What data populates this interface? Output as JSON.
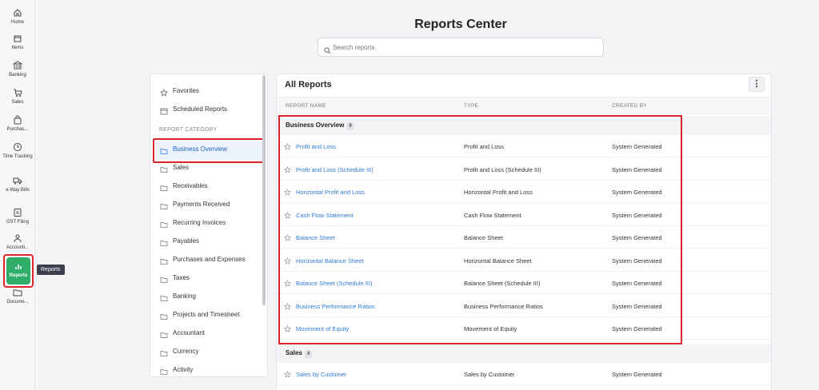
{
  "nav": {
    "items": [
      {
        "label": "Home",
        "icon": "home-icon"
      },
      {
        "label": "Items",
        "icon": "box-icon"
      },
      {
        "label": "Banking",
        "icon": "bank-icon"
      },
      {
        "label": "Sales",
        "icon": "cart-icon"
      },
      {
        "label": "Purchas...",
        "icon": "bag-icon"
      },
      {
        "label": "Time Tracking",
        "icon": "clock-icon"
      },
      {
        "label": "e-Way Bills",
        "icon": "truck-icon"
      },
      {
        "label": "GST Filing",
        "icon": "gst-icon"
      },
      {
        "label": "Accounti...",
        "icon": "user-icon"
      },
      {
        "label": "Reports",
        "icon": "chart-icon"
      },
      {
        "label": "Docume...",
        "icon": "folder-icon"
      }
    ],
    "tooltip": "Reports"
  },
  "header": {
    "title": "Reports Center",
    "search_placeholder": "Search reports"
  },
  "categories": {
    "top": [
      {
        "label": "Favorites",
        "icon": "star-icon"
      },
      {
        "label": "Scheduled Reports",
        "icon": "calendar-icon"
      }
    ],
    "heading": "REPORT CATEGORY",
    "items": [
      {
        "label": "Business Overview"
      },
      {
        "label": "Sales"
      },
      {
        "label": "Receivables"
      },
      {
        "label": "Payments Received"
      },
      {
        "label": "Recurring Invoices"
      },
      {
        "label": "Payables"
      },
      {
        "label": "Purchases and Expenses"
      },
      {
        "label": "Taxes"
      },
      {
        "label": "Banking"
      },
      {
        "label": "Projects and Timesheet"
      },
      {
        "label": "Accountant"
      },
      {
        "label": "Currency"
      },
      {
        "label": "Activity"
      }
    ],
    "selected": "Business Overview"
  },
  "main": {
    "title": "All Reports",
    "more_label": "⋮",
    "columns": {
      "name": "REPORT NAME",
      "type": "TYPE",
      "created_by": "CREATED BY"
    },
    "groups": [
      {
        "label": "Business Overview",
        "count": "9",
        "rows": [
          {
            "name": "Profit and Loss",
            "type": "Profit and Loss",
            "by": "System Generated"
          },
          {
            "name": "Profit and Loss (Schedule III)",
            "type": "Profit and Loss (Schedule III)",
            "by": "System Generated"
          },
          {
            "name": "Horizontal Profit and Loss",
            "type": "Horizontal Profit and Loss",
            "by": "System Generated"
          },
          {
            "name": "Cash Flow Statement",
            "type": "Cash Flow Statement",
            "by": "System Generated"
          },
          {
            "name": "Balance Sheet",
            "type": "Balance Sheet",
            "by": "System Generated"
          },
          {
            "name": "Horizontal Balance Sheet",
            "type": "Horizontal Balance Sheet",
            "by": "System Generated"
          },
          {
            "name": "Balance Sheet (Schedule III)",
            "type": "Balance Sheet (Schedule III)",
            "by": "System Generated"
          },
          {
            "name": "Business Performance Ratios",
            "type": "Business Performance Ratios",
            "by": "System Generated"
          },
          {
            "name": "Movement of Equity",
            "type": "Movement of Equity",
            "by": "System Generated"
          }
        ]
      },
      {
        "label": "Sales",
        "count": "4",
        "rows": [
          {
            "name": "Sales by Customer",
            "type": "Sales by Customer",
            "by": "System Generated"
          }
        ]
      }
    ]
  },
  "colors": {
    "accent": "#2f7ad8",
    "highlight": "#d9262c",
    "active_nav": "#2fae6a"
  }
}
